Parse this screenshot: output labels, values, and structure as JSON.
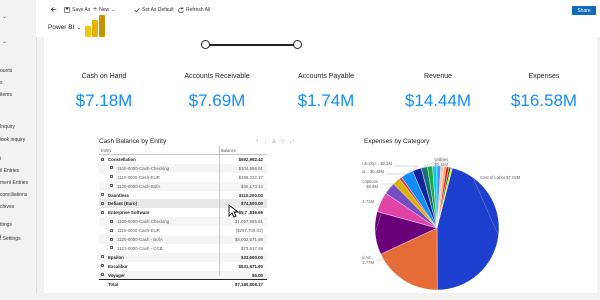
{
  "sidebar": {
    "items": [
      {
        "label": "",
        "has_chevron": true
      },
      {
        "label": "",
        "has_chevron": true
      },
      {
        "label": "ounts",
        "has_chevron": false
      },
      {
        "label": "s",
        "has_chevron": false
      },
      {
        "label": "items",
        "has_chevron": false
      },
      {
        "label": "Inquiry",
        "has_chevron": false
      },
      {
        "label": "iook inquiry",
        "has_chevron": false
      },
      {
        "label": "i",
        "has_chevron": false
      },
      {
        "label": "il Entries",
        "has_chevron": false
      },
      {
        "label": "ment Entries",
        "has_chevron": false
      },
      {
        "label": "conciliations",
        "has_chevron": false
      },
      {
        "label": "chives",
        "has_chevron": false
      },
      {
        "label": "ttings",
        "has_chevron": false
      },
      {
        "label": "i",
        "has_chevron": false
      },
      {
        "label": "l Settings",
        "has_chevron": false
      }
    ]
  },
  "toolbar": {
    "back_icon": "back-arrow-icon",
    "save_as": "Save As",
    "new": "New",
    "set_default": "Set As Default",
    "refresh_all": "Refresh All",
    "share": "Share"
  },
  "powerbi": {
    "label": "Power BI",
    "logo_colors": [
      "#f2c811",
      "#e8b100",
      "#c89300"
    ]
  },
  "kpis": [
    {
      "label": "Cash on Hand",
      "value": "$7.18M"
    },
    {
      "label": "Accounts Receivable",
      "value": "$7.69M"
    },
    {
      "label": "Accounts Payable",
      "value": "$1.74M"
    },
    {
      "label": "Revenue",
      "value": "$14.44M"
    },
    {
      "label": "Expenses",
      "value": "$16.58M"
    }
  ],
  "cash_table": {
    "title": "Cash Balance by Entity",
    "col_entity": "Entity",
    "col_balance": "Balance",
    "rows": [
      {
        "name": "Constellation",
        "balance": "$592,992.42",
        "level": 0,
        "expanded": true
      },
      {
        "name": "1100-0000-Cash-Checking",
        "balance": "$104,586.91",
        "level": 1
      },
      {
        "name": "1110-0000-Cash-EUR",
        "balance": "$398,222.37",
        "level": 1
      },
      {
        "name": "1120-0000-Cash-BofA",
        "balance": "$40,173.14",
        "level": 1
      },
      {
        "name": "Dauntless",
        "balance": "$110,200.00",
        "level": 0
      },
      {
        "name": "Defiant (Euro)",
        "balance": "$74,500.00",
        "level": 0,
        "highlight": true
      },
      {
        "name": "Enterprise Software",
        "balance": "$5,7 ,836.95",
        "level": 0,
        "expanded": true
      },
      {
        "name": "1100-0000-Cash-Checking",
        "balance": "$1,057,585.61",
        "level": 1
      },
      {
        "name": "1110-0000-Cash-EUR",
        "balance": "($297,709.02)",
        "level": 1
      },
      {
        "name": "1120-0000-Cash - BofA",
        "balance": "$5,002,571.86",
        "level": 1
      },
      {
        "name": "1121-0000-Cash - CCB",
        "balance": "$73,617.69",
        "level": 1
      },
      {
        "name": "Epsilon",
        "balance": "$33,600.00",
        "level": 0
      },
      {
        "name": "Excalibur",
        "balance": "$531,671.80",
        "level": 0
      },
      {
        "name": "Voyager",
        "balance": "$5.00",
        "level": 0
      }
    ],
    "total_label": "Total",
    "total_balance": "$7,180,808.17"
  },
  "expenses_chart": {
    "title": "Expenses by Category"
  },
  "chart_data": {
    "type": "pie",
    "title": "Expenses by Category",
    "series": [
      {
        "label": "Cost of Labor",
        "value_label": "$7.02M",
        "value": 7.02,
        "color": "#1c3fd0"
      },
      {
        "label": "Other General Ad...",
        "value_label": "$2.77M",
        "value": 2.77,
        "color": "#e66c37"
      },
      {
        "label": "Insurance",
        "value_label": "$1.71M",
        "value": 1.71,
        "color": "#6b007b"
      },
      {
        "label": "Dues & Subscriptions",
        "value_label": "$0.8M",
        "value": 0.8,
        "color": "#e044a7"
      },
      {
        "label": "Rent or Lea...",
        "value_label": "$0.48M",
        "value": 0.48,
        "color": "#744ec2"
      },
      {
        "label": "Postage & Shp...",
        "value_label": "$0.3M",
        "value": 0.3,
        "color": "#d9b300"
      },
      {
        "label": "Utilities",
        "value_label": "$0.11M",
        "value": 0.11,
        "color": "#d64550"
      },
      {
        "label": "",
        "value_label": "",
        "value": 0.5,
        "color": "#118dff"
      },
      {
        "label": "",
        "value_label": "",
        "value": 0.35,
        "color": "#12239e"
      },
      {
        "label": "",
        "value_label": "",
        "value": 0.25,
        "color": "#197278"
      },
      {
        "label": "",
        "value_label": "",
        "value": 0.2,
        "color": "#1aab40"
      },
      {
        "label": "",
        "value_label": "",
        "value": 0.18,
        "color": "#15c6f4"
      },
      {
        "label": "",
        "value_label": "",
        "value": 0.15,
        "color": "#4092ff"
      },
      {
        "label": "",
        "value_label": "",
        "value": 0.12,
        "color": "#f5c4af"
      },
      {
        "label": "",
        "value_label": "",
        "value": 0.1,
        "color": "#ffa058"
      },
      {
        "label": "",
        "value_label": "",
        "value": 0.1,
        "color": "#e81123"
      },
      {
        "label": "",
        "value_label": "",
        "value": 0.08,
        "color": "#107c10"
      },
      {
        "label": "",
        "value_label": "",
        "value": 0.06,
        "color": "#f2c80f"
      }
    ]
  }
}
